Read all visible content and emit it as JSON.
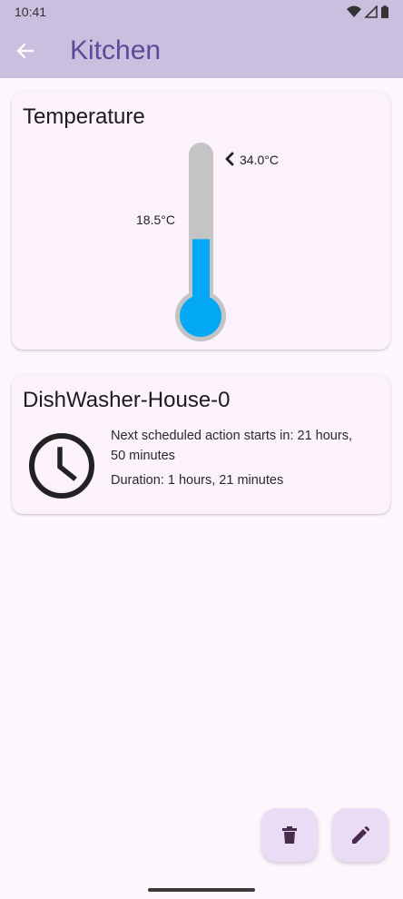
{
  "status_bar": {
    "time": "10:41"
  },
  "app_bar": {
    "title": "Kitchen"
  },
  "temperature_card": {
    "title": "Temperature",
    "current_label": "18.5°C",
    "current_value": 18.5,
    "max_label": "34.0°C",
    "max_value": 34.0,
    "fill_color": "#03a9f4"
  },
  "dishwasher_card": {
    "title": "DishWasher-House-0",
    "next_action": "Next scheduled action starts in: 21 hours,",
    "next_action_cont": "50 minutes",
    "duration": "Duration: 1 hours, 21 minutes"
  },
  "icons": {
    "back": "arrow-back",
    "clock": "schedule",
    "delete": "trash",
    "edit": "pencil"
  },
  "colors": {
    "app_bar": "#cbbfe0",
    "title": "#5a4a9a",
    "fab": "#eadcf4"
  }
}
